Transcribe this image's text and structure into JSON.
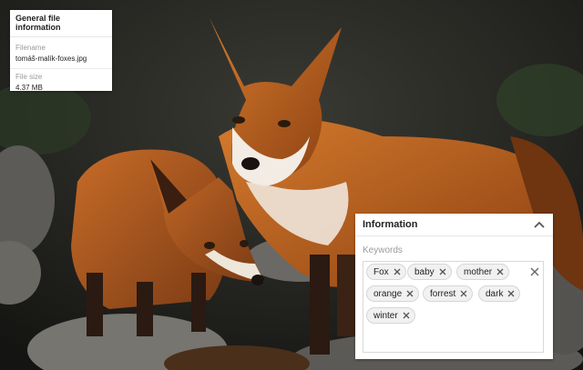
{
  "file_info": {
    "title": "General file information",
    "filename_label": "Filename",
    "filename_value": "tomáš-malík-foxes.jpg",
    "filesize_label": "File size",
    "filesize_value": "4.37 MB"
  },
  "information": {
    "title": "Information",
    "keywords_label": "Keywords",
    "keywords": [
      "Fox",
      "baby",
      "mother",
      "orange",
      "forrest",
      "dark",
      "winter"
    ]
  },
  "icons": {
    "collapse": "chevron-up-icon",
    "remove": "close-icon",
    "clear": "close-icon"
  }
}
